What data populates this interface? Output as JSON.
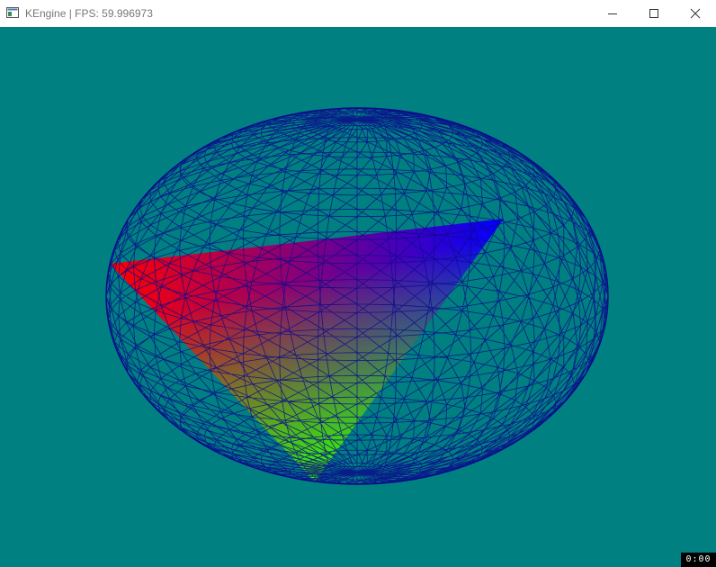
{
  "window": {
    "title": "KEngine | FPS: 59.996973",
    "controls": {
      "minimize_icon": "minimize-icon",
      "maximize_icon": "maximize-icon",
      "close_icon": "close-icon"
    }
  },
  "scene": {
    "background_color": "#008080",
    "wireframe_color": "#0a0a8c",
    "triangle_vertex_colors": [
      "#ff0000",
      "#0000ff",
      "#33ff00"
    ]
  },
  "overlay": {
    "timer": "0:00"
  }
}
